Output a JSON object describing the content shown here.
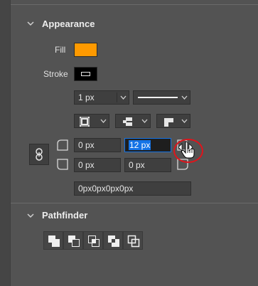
{
  "appearance": {
    "title": "Appearance",
    "fill_label": "Fill",
    "fill_color": "#ff9a00",
    "stroke_label": "Stroke",
    "stroke_width": "1 px",
    "stroke_style": "solid",
    "radius": {
      "top_left": "0 px",
      "top_right": "12 px",
      "bottom_left": "0 px",
      "bottom_right": "0 px"
    },
    "radius_css": "0px0px0px0px"
  },
  "pathfinder": {
    "title": "Pathfinder",
    "buttons": [
      "unite-icon",
      "minus-front-icon",
      "intersect-icon",
      "exclude-icon"
    ]
  },
  "colors": {
    "accent": "#1473e6",
    "highlight_circle": "#e0141b",
    "panel_bg": "#535353"
  }
}
